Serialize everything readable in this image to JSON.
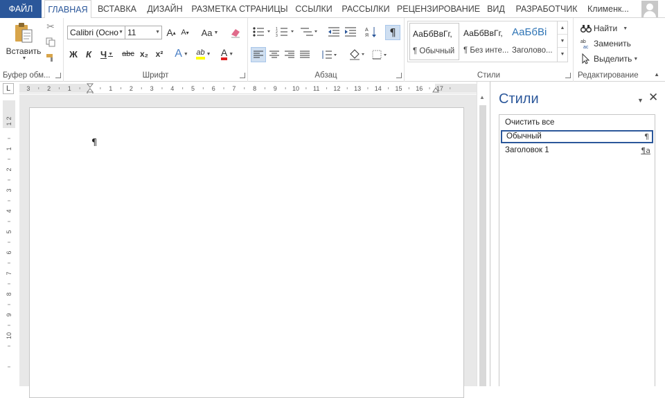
{
  "tabs": [
    "ФАЙЛ",
    "ГЛАВНАЯ",
    "ВСТАВКА",
    "ДИЗАЙН",
    "РАЗМЕТКА СТРАНИЦЫ",
    "ССЫЛКИ",
    "РАССЫЛКИ",
    "РЕЦЕНЗИРОВАНИЕ",
    "ВИД",
    "РАЗРАБОТЧИК"
  ],
  "active_tab": "ГЛАВНАЯ",
  "user": "Клименк...",
  "clipboard": {
    "paste_label": "Вставить",
    "group_label": "Буфер обм..."
  },
  "font": {
    "name": "Calibri (Осно",
    "size": "11",
    "grow_label": "A",
    "shrink_label": "A",
    "case_label": "Aa",
    "bold": "Ж",
    "italic": "К",
    "underline": "Ч",
    "strike": "abc",
    "subscript": "x₂",
    "superscript": "x²",
    "effects": "A",
    "highlight": "ab",
    "color_a": "A",
    "group_label": "Шрифт"
  },
  "paragraph": {
    "pilcrow": "¶",
    "group_label": "Абзац"
  },
  "styles": {
    "gallery": [
      {
        "sample": "АаБбВвГг,",
        "name": "¶ Обычный"
      },
      {
        "sample": "АаБбВвГг,",
        "name": "¶ Без инте..."
      },
      {
        "sample": "АаБбВі",
        "name": "Заголово..."
      }
    ],
    "group_label": "Стили"
  },
  "editing": {
    "find": "Найти",
    "replace": "Заменить",
    "select": "Выделить",
    "group_label": "Редактирование"
  },
  "ruler": {
    "h_numbers": [
      "3",
      "2",
      "1",
      "1",
      "2",
      "3",
      "4",
      "5",
      "6",
      "7",
      "8",
      "9",
      "10",
      "11",
      "12",
      "13",
      "14",
      "15",
      "16",
      "17"
    ],
    "v_numbers": [
      "2",
      "1",
      "1",
      "2",
      "3",
      "4",
      "5",
      "6",
      "7",
      "8",
      "9",
      "10"
    ],
    "corner": "L"
  },
  "document": {
    "mark": "¶"
  },
  "pane": {
    "title": "Стили",
    "items": [
      {
        "label": "Очистить все",
        "mark": ""
      },
      {
        "label": "Обычный",
        "mark": "¶"
      },
      {
        "label": "Заголовок 1",
        "mark": "¶a"
      }
    ]
  },
  "colors": {
    "accent": "#2b579a",
    "highlight": "#ffff00",
    "font_color": "#e02020"
  }
}
